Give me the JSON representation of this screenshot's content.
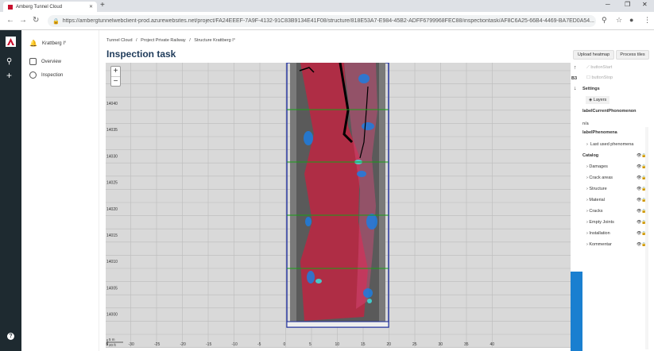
{
  "browser": {
    "tab_title": "Amberg Tunnel Cloud",
    "url": "https://ambergtunnelwebclient-prod.azurewebsites.net/project/FA24EEEF-7A9F-4132-91C83B9134E41F08/structure/818E53A7-E984-45B2-ADFF6799968FEC88/inspectiontask/AF8C6A25-66B4-4469-BA7ED0A54..."
  },
  "sidemenu": {
    "project": "Krattberg I°",
    "items": [
      "Overview",
      "Inspection"
    ]
  },
  "breadcrumb": [
    "Tunnel Cloud",
    "/",
    "Project Private Railway",
    "/",
    "Structure Krattberg I°"
  ],
  "page_title": "Inspection task",
  "map": {
    "y_ticks": [
      "14040",
      "14035",
      "14030",
      "14025",
      "14020",
      "14015",
      "14010",
      "14005",
      "14000"
    ],
    "x_ticks": [
      "-40",
      "-35",
      "-30",
      "-25",
      "-20",
      "-15",
      "-10",
      "-5",
      "0",
      "5",
      "10",
      "15",
      "20",
      "25",
      "30",
      "35",
      "40"
    ],
    "scale_label": "5 m",
    "scale_sub": "20 ft"
  },
  "panel": {
    "upload_heatmap": "Upload heatmap",
    "process_tiles": "Process tiles",
    "button_start": "buttonStart",
    "button_stop": "buttonStop",
    "b3": "B3",
    "settings": "Settings",
    "layers": "Layers",
    "label_current": "labelCurrentPhonomenon",
    "na": "n/a",
    "label_phenomena": "labelPhenomena",
    "last_used": "Last used phenomena",
    "catalog": "Catalog",
    "catalog_items": [
      "Damages",
      "Crack areas",
      "Structure",
      "Material",
      "Cracks",
      "Empty Joints",
      "Installation",
      "Kommentar"
    ]
  }
}
